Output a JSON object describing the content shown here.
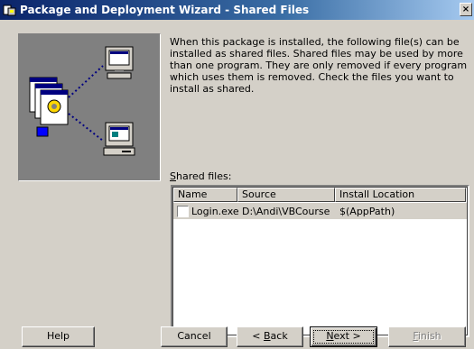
{
  "window": {
    "title": "Package and Deployment Wizard - Shared Files",
    "close_label": "×"
  },
  "description": "When this package is installed, the following file(s) can be installed as shared files. Shared files may be used by more than one program. They are only removed if every program which uses them is removed. Check the files you want to install as shared.",
  "shared_files": {
    "label_first": "S",
    "label_rest": "hared files:",
    "columns": [
      "Name",
      "Source",
      "Install Location"
    ],
    "rows": [
      {
        "checked": false,
        "name": "Login.exe",
        "source": "D:\\Andi\\VBCourse",
        "install_location": "$(AppPath)"
      }
    ]
  },
  "buttons": {
    "help": "Help",
    "cancel": "Cancel",
    "back_accel": "< ",
    "back_ul": "B",
    "back_rest": "ack",
    "next_ul": "N",
    "next_rest": "ext >",
    "finish_ul": "F",
    "finish_rest": "inish"
  },
  "icons": [
    "app-icon",
    "close-icon",
    "document-stack-icon",
    "monitor-icon",
    "computer-icon"
  ],
  "colors": {
    "titlebar_start": "#0a246a",
    "titlebar_end": "#a6caf0",
    "dialog_face": "#d4d0c8",
    "illustration_bg": "#808080"
  }
}
